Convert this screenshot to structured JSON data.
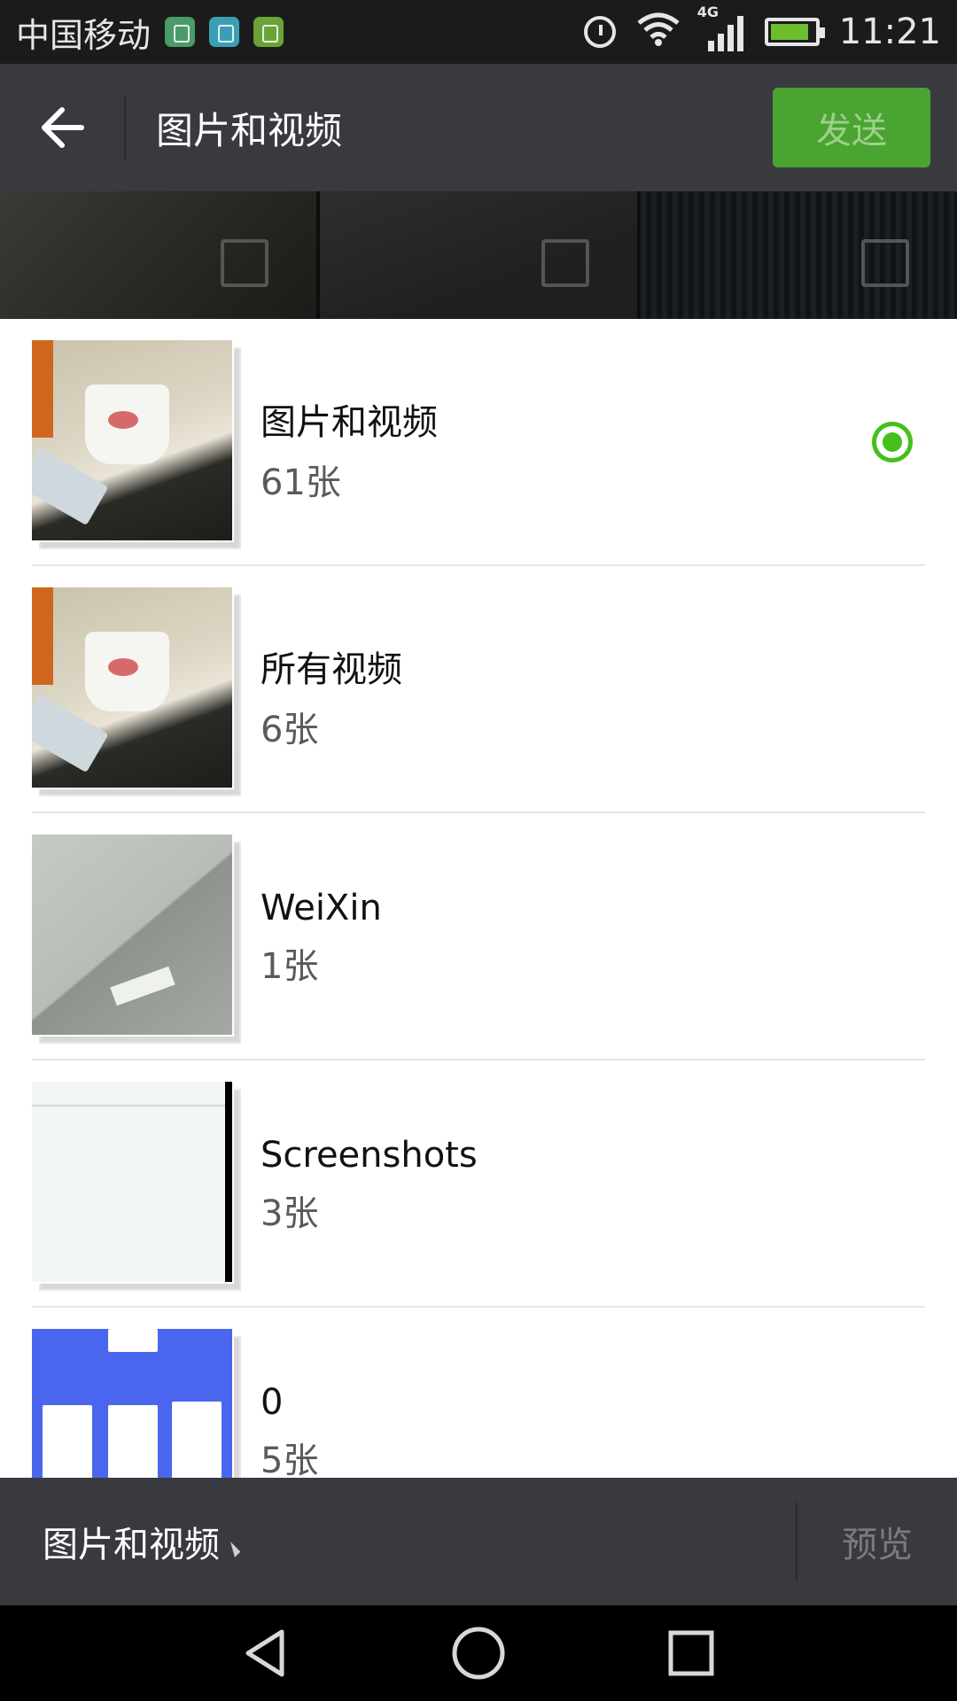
{
  "status_bar": {
    "carrier": "中国移动",
    "network": "4G",
    "time": "11:21",
    "icons": [
      "usb-debug-icon",
      "android-icon",
      "bot-icon",
      "alarm-icon",
      "wifi-icon",
      "signal-icon",
      "battery-charging-icon"
    ],
    "battery_level": 0.9
  },
  "header": {
    "title": "图片和视频",
    "send_label": "发送"
  },
  "albums": [
    {
      "name": "图片和视频",
      "count": "61张",
      "selected": true
    },
    {
      "name": "所有视频",
      "count": "6张",
      "selected": false
    },
    {
      "name": "WeiXin",
      "count": "1张",
      "selected": false
    },
    {
      "name": "Screenshots",
      "count": "3张",
      "selected": false
    },
    {
      "name": "0",
      "count": "5张",
      "selected": false
    }
  ],
  "bottom_bar": {
    "current_folder": "图片和视频",
    "preview_label": "预览"
  },
  "colors": {
    "accent_green": "#45c01a",
    "send_button": "#4aa432",
    "toolbar": "#393a3f"
  }
}
